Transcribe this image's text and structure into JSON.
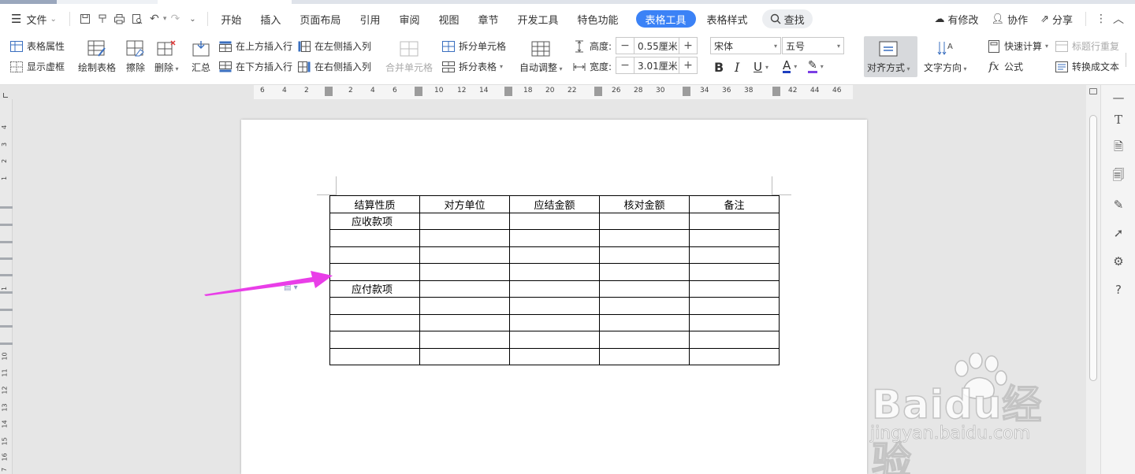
{
  "menu": {
    "file_label": "文件",
    "tabs": [
      "开始",
      "插入",
      "页面布局",
      "引用",
      "审阅",
      "视图",
      "章节",
      "开发工具",
      "特色功能"
    ],
    "active_tab": "表格工具",
    "context_tab": "表格样式",
    "search_label": "查找",
    "right": {
      "modified": "有修改",
      "collab": "协作",
      "share": "分享"
    }
  },
  "ribbon": {
    "table_props": "表格属性",
    "show_gridlines": "显示虚框",
    "draw_table": "绘制表格",
    "erase": "擦除",
    "delete": "删除",
    "summary": "汇总",
    "insert_above": "在上方插入行",
    "insert_below": "在下方插入行",
    "insert_left": "在左侧插入列",
    "insert_right": "在右侧插入列",
    "merge_cells": "合并单元格",
    "split_cells": "拆分单元格",
    "split_table": "拆分表格",
    "auto_fit": "自动调整",
    "height_label": "高度:",
    "height_value": "0.55厘米",
    "width_label": "宽度:",
    "width_value": "3.01厘米",
    "font_name": "宋体",
    "font_size": "五号",
    "align": "对齐方式",
    "text_direction": "文字方向",
    "quick_calc": "快速计算",
    "header_repeat": "标题行重复",
    "formula": "公式",
    "to_text": "转换成文本"
  },
  "ruler_numbers": [
    "6",
    "4",
    "2",
    "2",
    "4",
    "6",
    "10",
    "12",
    "14",
    "18",
    "20",
    "22",
    "26",
    "28",
    "30",
    "34",
    "36",
    "38",
    "42",
    "44",
    "46"
  ],
  "vruler_numbers": [
    "4",
    "3",
    "2",
    "1",
    "1",
    "10",
    "11",
    "12",
    "13",
    "14",
    "15",
    "16",
    "7"
  ],
  "table": {
    "headers": [
      "结算性质",
      "对方单位",
      "应结金额",
      "核对金额",
      "备注"
    ],
    "rows": [
      [
        "应收款项",
        "",
        "",
        "",
        ""
      ],
      [
        "",
        "",
        "",
        "",
        ""
      ],
      [
        "",
        "",
        "",
        "",
        ""
      ],
      [
        "",
        "",
        "",
        "",
        ""
      ],
      [
        "应付款项",
        "",
        "",
        "",
        ""
      ],
      [
        "",
        "",
        "",
        "",
        ""
      ],
      [
        "",
        "",
        "",
        "",
        ""
      ],
      [
        "",
        "",
        "",
        "",
        ""
      ],
      [
        "",
        "",
        "",
        "",
        ""
      ]
    ]
  },
  "annotation": {
    "arrow_color": "#e93ee8"
  },
  "colors": {
    "accent": "#3b82f6",
    "font_color_underline": "#1f3fbf",
    "highlight_underline": "#7b3fe4"
  },
  "watermark": {
    "brand": "Baidu经验",
    "url": "jingyan.baidu.com"
  }
}
